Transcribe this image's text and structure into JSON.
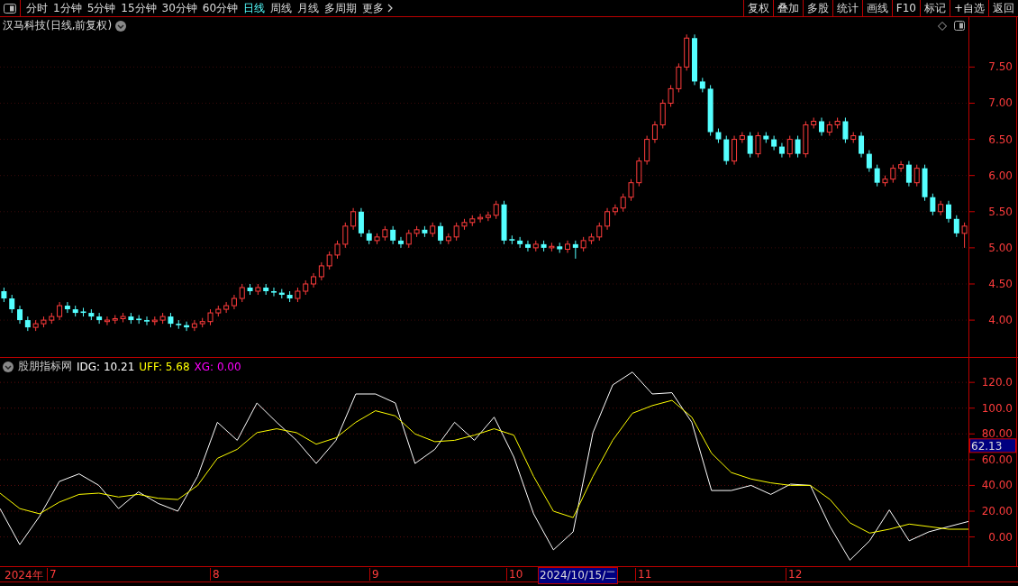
{
  "toolbar": {
    "periods": [
      {
        "label": "分时",
        "selected": false
      },
      {
        "label": "1分钟",
        "selected": false
      },
      {
        "label": "5分钟",
        "selected": false
      },
      {
        "label": "15分钟",
        "selected": false
      },
      {
        "label": "30分钟",
        "selected": false
      },
      {
        "label": "60分钟",
        "selected": false
      },
      {
        "label": "日线",
        "selected": true
      },
      {
        "label": "周线",
        "selected": false
      },
      {
        "label": "月线",
        "selected": false
      },
      {
        "label": "多周期",
        "selected": false
      }
    ],
    "more": "更多",
    "actions": [
      "复权",
      "叠加",
      "多股",
      "统计",
      "画线",
      "F10",
      "标记",
      "+自选",
      "返回"
    ]
  },
  "price_panel": {
    "title": "汉马科技(日线,前复权)",
    "chart_data": {
      "type": "candlestick",
      "ylim": [
        3.49,
        8.19
      ],
      "grid": true,
      "yticks": [
        {
          "value": 7.5,
          "label": "7.50"
        },
        {
          "value": 7,
          "label": "7.00"
        },
        {
          "value": 6.5,
          "label": "6.50"
        },
        {
          "value": 6,
          "label": "6.00"
        },
        {
          "value": 5.5,
          "label": "5.50"
        },
        {
          "value": 5,
          "label": "5.00"
        },
        {
          "value": 4.5,
          "label": "4.50"
        },
        {
          "value": 4,
          "label": "4.00"
        }
      ],
      "ohlc": [
        [
          4.4,
          4.45,
          4.25,
          4.3
        ],
        [
          4.3,
          4.35,
          4.1,
          4.15
        ],
        [
          4.15,
          4.2,
          3.95,
          4.0
        ],
        [
          4.0,
          4.05,
          3.85,
          3.9
        ],
        [
          3.9,
          4.0,
          3.85,
          3.95
        ],
        [
          3.95,
          4.05,
          3.9,
          4.0
        ],
        [
          4.0,
          4.1,
          3.95,
          4.05
        ],
        [
          4.05,
          4.25,
          4.0,
          4.2
        ],
        [
          4.2,
          4.25,
          4.1,
          4.15
        ],
        [
          4.15,
          4.2,
          4.05,
          4.1
        ],
        [
          4.12,
          4.17,
          4.05,
          4.1
        ],
        [
          4.1,
          4.15,
          4.0,
          4.05
        ],
        [
          4.05,
          4.1,
          3.95,
          4.0
        ],
        [
          3.98,
          4.05,
          3.93,
          4.0
        ],
        [
          4.0,
          4.07,
          3.95,
          4.02
        ],
        [
          4.02,
          4.1,
          3.97,
          4.05
        ],
        [
          4.05,
          4.1,
          3.95,
          4.0
        ],
        [
          4.02,
          4.07,
          3.95,
          4.0
        ],
        [
          4.0,
          4.05,
          3.93,
          3.98
        ],
        [
          3.98,
          4.05,
          3.93,
          4.0
        ],
        [
          4.0,
          4.1,
          3.95,
          4.05
        ],
        [
          4.05,
          4.1,
          3.9,
          3.95
        ],
        [
          3.95,
          4.0,
          3.88,
          3.93
        ],
        [
          3.93,
          3.98,
          3.85,
          3.9
        ],
        [
          3.9,
          4.0,
          3.85,
          3.95
        ],
        [
          3.95,
          4.03,
          3.9,
          3.98
        ],
        [
          3.98,
          4.15,
          3.93,
          4.1
        ],
        [
          4.1,
          4.2,
          4.05,
          4.15
        ],
        [
          4.15,
          4.25,
          4.1,
          4.2
        ],
        [
          4.2,
          4.35,
          4.15,
          4.3
        ],
        [
          4.3,
          4.5,
          4.25,
          4.45
        ],
        [
          4.45,
          4.5,
          4.35,
          4.4
        ],
        [
          4.4,
          4.5,
          4.35,
          4.45
        ],
        [
          4.45,
          4.5,
          4.35,
          4.4
        ],
        [
          4.4,
          4.45,
          4.33,
          4.38
        ],
        [
          4.38,
          4.43,
          4.3,
          4.35
        ],
        [
          4.35,
          4.4,
          4.25,
          4.3
        ],
        [
          4.3,
          4.45,
          4.25,
          4.4
        ],
        [
          4.4,
          4.55,
          4.35,
          4.5
        ],
        [
          4.5,
          4.65,
          4.45,
          4.6
        ],
        [
          4.6,
          4.8,
          4.55,
          4.75
        ],
        [
          4.75,
          4.95,
          4.7,
          4.9
        ],
        [
          4.9,
          5.1,
          4.85,
          5.05
        ],
        [
          5.05,
          5.35,
          5.0,
          5.3
        ],
        [
          5.3,
          5.55,
          5.25,
          5.5
        ],
        [
          5.5,
          5.55,
          5.15,
          5.2
        ],
        [
          5.2,
          5.25,
          5.05,
          5.1
        ],
        [
          5.1,
          5.2,
          5.05,
          5.15
        ],
        [
          5.15,
          5.3,
          5.1,
          5.25
        ],
        [
          5.25,
          5.3,
          5.05,
          5.1
        ],
        [
          5.1,
          5.15,
          5.0,
          5.05
        ],
        [
          5.05,
          5.25,
          5.0,
          5.2
        ],
        [
          5.2,
          5.3,
          5.15,
          5.25
        ],
        [
          5.25,
          5.3,
          5.15,
          5.2
        ],
        [
          5.2,
          5.35,
          5.15,
          5.3
        ],
        [
          5.3,
          5.35,
          5.05,
          5.1
        ],
        [
          5.1,
          5.2,
          5.05,
          5.15
        ],
        [
          5.15,
          5.35,
          5.1,
          5.3
        ],
        [
          5.3,
          5.4,
          5.25,
          5.35
        ],
        [
          5.35,
          5.45,
          5.3,
          5.4
        ],
        [
          5.4,
          5.47,
          5.35,
          5.42
        ],
        [
          5.42,
          5.5,
          5.37,
          5.45
        ],
        [
          5.45,
          5.65,
          5.4,
          5.6
        ],
        [
          5.6,
          5.65,
          5.05,
          5.1
        ],
        [
          5.12,
          5.17,
          5.05,
          5.1
        ],
        [
          5.1,
          5.15,
          5.0,
          5.05
        ],
        [
          5.05,
          5.1,
          4.95,
          5.0
        ],
        [
          5.0,
          5.1,
          4.95,
          5.05
        ],
        [
          5.05,
          5.1,
          4.95,
          5.0
        ],
        [
          5.0,
          5.07,
          4.95,
          5.02
        ],
        [
          5.02,
          5.07,
          4.93,
          4.98
        ],
        [
          4.98,
          5.1,
          4.93,
          5.05
        ],
        [
          5.05,
          5.1,
          4.85,
          5.0
        ],
        [
          5.0,
          5.15,
          4.95,
          5.1
        ],
        [
          5.1,
          5.2,
          5.05,
          5.15
        ],
        [
          5.15,
          5.35,
          5.1,
          5.3
        ],
        [
          5.3,
          5.55,
          5.25,
          5.5
        ],
        [
          5.5,
          5.6,
          5.45,
          5.55
        ],
        [
          5.55,
          5.75,
          5.5,
          5.7
        ],
        [
          5.7,
          5.95,
          5.65,
          5.9
        ],
        [
          5.9,
          6.25,
          5.85,
          6.2
        ],
        [
          6.2,
          6.55,
          6.15,
          6.5
        ],
        [
          6.5,
          6.75,
          6.45,
          6.7
        ],
        [
          6.7,
          7.05,
          6.65,
          7.0
        ],
        [
          7.0,
          7.25,
          6.95,
          7.2
        ],
        [
          7.2,
          7.55,
          7.15,
          7.5
        ],
        [
          7.5,
          7.95,
          7.45,
          7.9
        ],
        [
          7.9,
          7.95,
          7.25,
          7.3
        ],
        [
          7.3,
          7.35,
          7.15,
          7.2
        ],
        [
          7.2,
          7.25,
          6.55,
          6.6
        ],
        [
          6.6,
          6.65,
          6.45,
          6.5
        ],
        [
          6.5,
          6.55,
          6.15,
          6.2
        ],
        [
          6.2,
          6.55,
          6.15,
          6.5
        ],
        [
          6.5,
          6.6,
          6.45,
          6.55
        ],
        [
          6.55,
          6.6,
          6.25,
          6.3
        ],
        [
          6.3,
          6.6,
          6.25,
          6.55
        ],
        [
          6.55,
          6.6,
          6.45,
          6.5
        ],
        [
          6.5,
          6.55,
          6.35,
          6.4
        ],
        [
          6.4,
          6.45,
          6.25,
          6.3
        ],
        [
          6.3,
          6.55,
          6.25,
          6.5
        ],
        [
          6.5,
          6.55,
          6.25,
          6.3
        ],
        [
          6.3,
          6.75,
          6.25,
          6.7
        ],
        [
          6.7,
          6.8,
          6.65,
          6.75
        ],
        [
          6.75,
          6.8,
          6.55,
          6.6
        ],
        [
          6.6,
          6.75,
          6.55,
          6.7
        ],
        [
          6.7,
          6.8,
          6.65,
          6.75
        ],
        [
          6.75,
          6.8,
          6.45,
          6.5
        ],
        [
          6.5,
          6.6,
          6.45,
          6.55
        ],
        [
          6.55,
          6.6,
          6.25,
          6.3
        ],
        [
          6.3,
          6.35,
          6.05,
          6.1
        ],
        [
          6.1,
          6.15,
          5.85,
          5.9
        ],
        [
          5.9,
          6.0,
          5.85,
          5.95
        ],
        [
          5.95,
          6.15,
          5.9,
          6.1
        ],
        [
          6.1,
          6.2,
          6.05,
          6.15
        ],
        [
          6.15,
          6.2,
          5.85,
          5.9
        ],
        [
          5.9,
          6.15,
          5.85,
          6.1
        ],
        [
          6.1,
          6.15,
          5.65,
          5.7
        ],
        [
          5.7,
          5.75,
          5.45,
          5.5
        ],
        [
          5.5,
          5.65,
          5.45,
          5.6
        ],
        [
          5.6,
          5.65,
          5.35,
          5.4
        ],
        [
          5.4,
          5.45,
          5.15,
          5.2
        ],
        [
          5.2,
          5.35,
          5.0,
          5.3
        ]
      ]
    }
  },
  "indicator_panel": {
    "name": "股朋指标网",
    "readouts": [
      {
        "label": "IDG: 10.21",
        "color": "#ffffff"
      },
      {
        "label": "UFF: 5.68",
        "color": "#ffff00"
      },
      {
        "label": "XG: 0.00",
        "color": "#ff00ff"
      }
    ],
    "cursor_value": "62.13",
    "chart_data": {
      "type": "line",
      "ylim": [
        -22.7,
        139
      ],
      "grid": true,
      "yticks": [
        {
          "value": 0,
          "label": "0.00"
        },
        {
          "value": 20,
          "label": "20.00"
        },
        {
          "value": 40,
          "label": "40.00"
        },
        {
          "value": 60,
          "label": "60.00"
        },
        {
          "value": 80,
          "label": "80.00"
        },
        {
          "value": 100,
          "label": "100.0"
        },
        {
          "value": 120,
          "label": "120.0"
        }
      ],
      "series": [
        {
          "color": "#ffffff",
          "values": [
            22,
            -6,
            16,
            43,
            49,
            40,
            22,
            35,
            26,
            20,
            47,
            89,
            75,
            104,
            89,
            75,
            57,
            75,
            111,
            111,
            104,
            57,
            68,
            89,
            75,
            93,
            62,
            18,
            -10,
            4,
            81,
            118,
            128,
            111,
            112,
            89,
            36,
            36,
            40,
            33,
            41,
            40,
            8,
            -18,
            -3,
            21,
            -3,
            4,
            8,
            12
          ]
        },
        {
          "color": "#ffff00",
          "values": [
            34,
            22,
            18,
            27,
            33,
            34,
            31,
            33,
            30,
            29,
            40,
            61,
            68,
            81,
            84,
            81,
            72,
            77,
            89,
            98,
            94,
            80,
            74,
            75,
            79,
            84,
            79,
            47,
            20,
            15,
            47,
            75,
            96,
            102,
            106,
            93,
            65,
            50,
            45,
            42,
            40,
            40,
            29,
            11,
            3,
            6,
            10,
            8,
            6,
            6
          ]
        }
      ]
    }
  },
  "time_axis": [
    {
      "label": "2024年",
      "kind": "year"
    },
    {
      "label": "7",
      "kind": "month"
    },
    {
      "label": "8",
      "kind": "month"
    },
    {
      "label": "9",
      "kind": "month"
    },
    {
      "label": "10",
      "kind": "month"
    },
    {
      "label": "2024/10/15/二",
      "kind": "cursor"
    },
    {
      "label": "11",
      "kind": "month"
    },
    {
      "label": "12",
      "kind": "month"
    }
  ]
}
